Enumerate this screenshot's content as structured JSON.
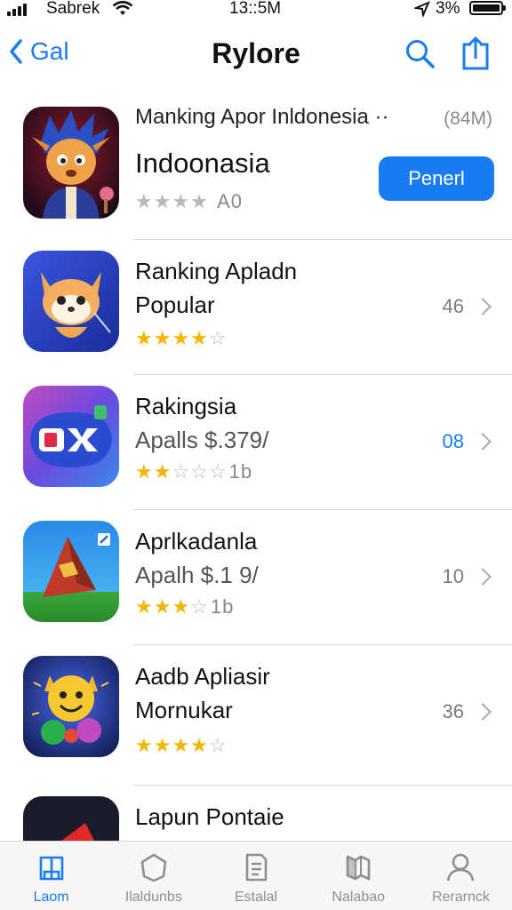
{
  "status_bar": {
    "carrier": "Sabrek",
    "time": "13::5M",
    "battery_pct": "3%"
  },
  "nav": {
    "back_label": "Gal",
    "title": "Rylore",
    "icons": [
      "search-icon",
      "share-icon"
    ]
  },
  "featured": {
    "header": "Manking Apor Inldonesia",
    "header_dots": "··",
    "size": "(84M)",
    "title": "Indoonasia",
    "rating_label": "A0",
    "stars": 4,
    "button_label": "Penerl",
    "accent": "#1a7cf2"
  },
  "rows": [
    {
      "line1": "Ranking Apladn",
      "line2": "Popular",
      "stars": 4,
      "rating_text": "",
      "count": "46",
      "count_color": "grey"
    },
    {
      "line1": "Rakingsia",
      "line2": "Apalls $.379/",
      "stars": 2.5,
      "rating_text": "1b",
      "count": "08",
      "count_color": "blue"
    },
    {
      "line1": "Aprlkadanla",
      "line2": "Apalh $.1 9/",
      "stars": 3,
      "rating_text": "1b",
      "count": "10",
      "count_color": "grey"
    },
    {
      "line1": "Aadb Apliasir",
      "line2": "Mornukar",
      "stars": 4,
      "rating_text": "",
      "count": "36",
      "count_color": "grey"
    },
    {
      "line1": "Lapun Pontaie",
      "line2": "",
      "stars": 0,
      "rating_text": "",
      "count": "",
      "count_color": "grey"
    }
  ],
  "tabs": [
    {
      "label": "Laom",
      "icon": "book-icon",
      "active": true
    },
    {
      "label": "Ilaldunbs",
      "icon": "hexagon-icon",
      "active": false
    },
    {
      "label": "Estalal",
      "icon": "document-icon",
      "active": false
    },
    {
      "label": "Nalabao",
      "icon": "map-icon",
      "active": false
    },
    {
      "label": "Rerarnck",
      "icon": "person-icon",
      "active": false
    }
  ],
  "colors": {
    "star": "#f5b400",
    "accent": "#1a7cf2"
  }
}
